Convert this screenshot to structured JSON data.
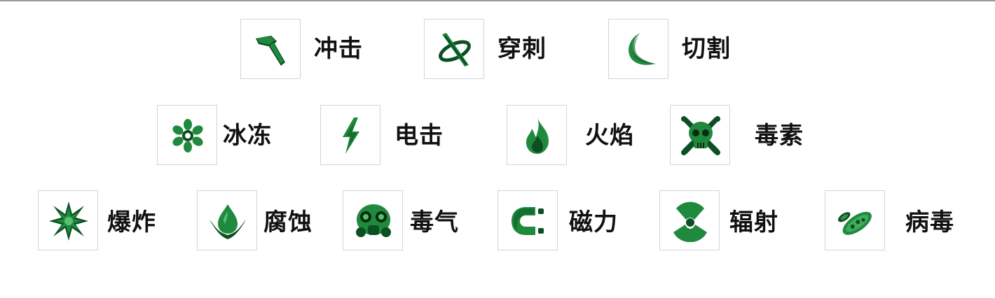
{
  "damage_types": [
    {
      "id": "impact",
      "label": "冲击",
      "icon": "hammer-icon"
    },
    {
      "id": "puncture",
      "label": "穿刺",
      "icon": "spike-ring-icon"
    },
    {
      "id": "slash",
      "label": "切割",
      "icon": "crescent-blade-icon"
    },
    {
      "id": "cold",
      "label": "冰冻",
      "icon": "snowflake-icon"
    },
    {
      "id": "electricity",
      "label": "电击",
      "icon": "lightning-bolt-icon"
    },
    {
      "id": "heat",
      "label": "火焰",
      "icon": "flame-icon"
    },
    {
      "id": "toxin",
      "label": "毒素",
      "icon": "skull-crossbones-icon"
    },
    {
      "id": "blast",
      "label": "爆炸",
      "icon": "explosion-burst-icon"
    },
    {
      "id": "corrosive",
      "label": "腐蚀",
      "icon": "corrosive-drop-icon"
    },
    {
      "id": "gas",
      "label": "毒气",
      "icon": "gas-mask-icon"
    },
    {
      "id": "magnetic",
      "label": "磁力",
      "icon": "magnet-icon"
    },
    {
      "id": "radiation",
      "label": "辐射",
      "icon": "radiation-icon"
    },
    {
      "id": "viral",
      "label": "病毒",
      "icon": "virus-icon"
    }
  ],
  "colors": {
    "icon_green": "#1f8a3d",
    "icon_dark": "#0b4f22",
    "icon_light": "#57c16e",
    "tile_border": "#cfd6dc"
  }
}
